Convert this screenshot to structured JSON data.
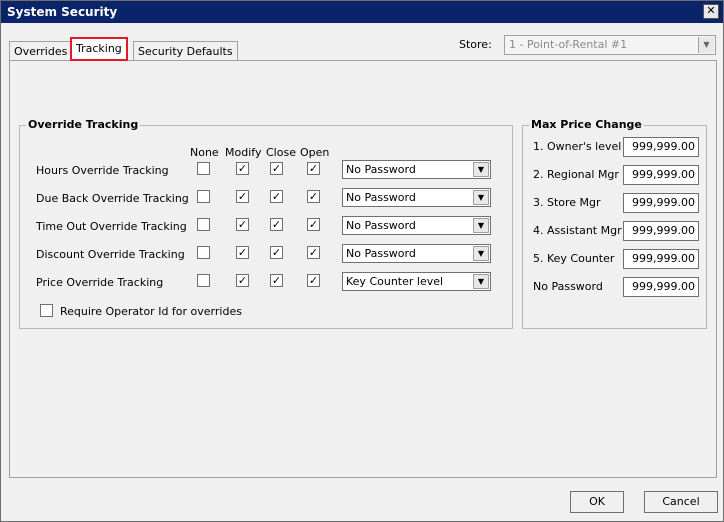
{
  "window": {
    "title": "System Security",
    "close_glyph": "✕"
  },
  "tabs": [
    {
      "label": "Overrides",
      "active": false
    },
    {
      "label": "Tracking",
      "active": true
    },
    {
      "label": "Security Defaults",
      "active": false
    }
  ],
  "store": {
    "label": "Store:",
    "value": "1 - Point-of-Rental #1"
  },
  "override_tracking": {
    "title": "Override Tracking",
    "columns": [
      "None",
      "Modify",
      "Close",
      "Open"
    ],
    "rows": [
      {
        "label": "Hours Override Tracking",
        "checks": [
          false,
          true,
          true,
          true
        ],
        "level": "No Password"
      },
      {
        "label": "Due Back Override Tracking",
        "checks": [
          false,
          true,
          true,
          true
        ],
        "level": "No Password"
      },
      {
        "label": "Time Out Override Tracking",
        "checks": [
          false,
          true,
          true,
          true
        ],
        "level": "No Password"
      },
      {
        "label": "Discount Override Tracking",
        "checks": [
          false,
          true,
          true,
          true
        ],
        "level": "No Password"
      },
      {
        "label": "Price Override Tracking",
        "checks": [
          false,
          true,
          true,
          true
        ],
        "level": "Key Counter level"
      }
    ],
    "require_operator": {
      "label": "Require Operator Id for overrides",
      "checked": false
    }
  },
  "max_price_change": {
    "title": "Max Price Change",
    "rows": [
      {
        "label": "1. Owner's level",
        "value": "999,999.00"
      },
      {
        "label": "2. Regional Mgr",
        "value": "999,999.00"
      },
      {
        "label": "3. Store Mgr",
        "value": "999,999.00"
      },
      {
        "label": "4. Assistant Mgr",
        "value": "999,999.00"
      },
      {
        "label": "5. Key Counter",
        "value": "999,999.00"
      },
      {
        "label": "No Password",
        "value": "999,999.00"
      }
    ]
  },
  "buttons": {
    "ok": "OK",
    "cancel": "Cancel"
  },
  "icons": {
    "check": "✓",
    "dropdown_arrow": "▼"
  },
  "colors": {
    "titlebar": "#0a246a",
    "tab_highlight": "#e01b24"
  }
}
